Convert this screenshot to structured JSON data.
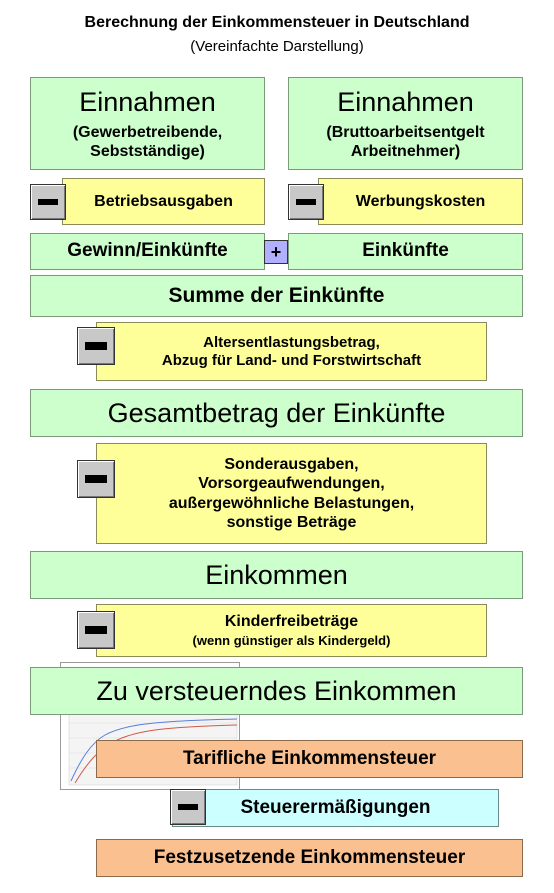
{
  "header": {
    "title": "Berechnung der Einkommensteuer in Deutschland",
    "subtitle": "(Vereinfachte Darstellung)"
  },
  "boxes": {
    "einnahmen_left": {
      "title": "Einnahmen",
      "sub1": "(Gewerbetreibende,",
      "sub2": "Sebstständige)"
    },
    "einnahmen_right": {
      "title": "Einnahmen",
      "sub1": "(Bruttoarbeitsentgelt",
      "sub2": "Arbeitnehmer)"
    },
    "betriebsausgaben": "Betriebsausgaben",
    "werbungskosten": "Werbungskosten",
    "gewinn": "Gewinn/Einkünfte",
    "einkuenfte": "Einkünfte",
    "summe": "Summe der Einkünfte",
    "altersentlastung": {
      "line1": "Altersentlastungsbetrag,",
      "line2": "Abzug für Land- und Forstwirtschaft"
    },
    "gesamtbetrag": "Gesamtbetrag der Einkünfte",
    "sonderausgaben": {
      "line1": "Sonderausgaben,",
      "line2": "Vorsorgeaufwendungen,",
      "line3": "außergewöhnliche Belastungen,",
      "line4": "sonstige Beträge"
    },
    "einkommen": "Einkommen",
    "kinderfreibetraege": {
      "line1": "Kinderfreibeträge",
      "line2": "(wenn günstiger als Kindergeld)"
    },
    "zu_versteuern": "Zu versteuerndes Einkommen",
    "tarifliche": "Tarifliche Einkommensteuer",
    "steuerermaessigungen": "Steuerermäßigungen",
    "festzusetzende": "Festzusetzende Einkommensteuer"
  },
  "operators": {
    "minus": "minus-operator",
    "plus_symbol": "+"
  },
  "colors": {
    "income_green": "#ccffcc",
    "deduction_yellow": "#ffff99",
    "tax_orange": "#fac090",
    "reduction_cyan": "#ccffff",
    "operator_gray": "#c8c8c8",
    "plus_blue": "#b0b0ff"
  }
}
